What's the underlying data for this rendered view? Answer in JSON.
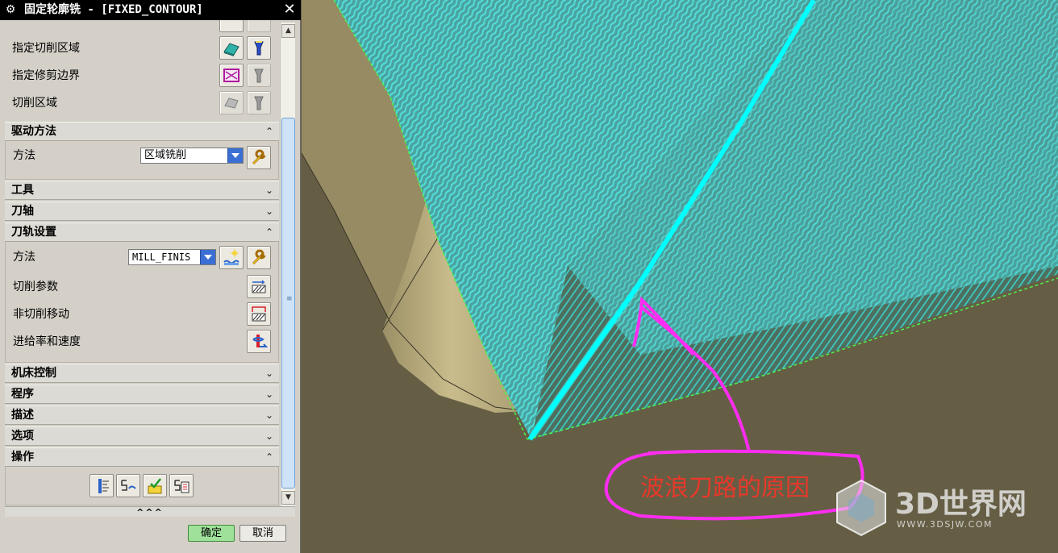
{
  "dialog": {
    "title": "固定轮廓铣 - [FIXED_CONTOUR]",
    "top_rows": [
      {
        "label": "指定切削区域"
      },
      {
        "label": "指定修剪边界"
      },
      {
        "label": "切削区域"
      }
    ],
    "sections": {
      "drive_method": {
        "title": "驱动方法",
        "method_label": "方法",
        "method_value": "区域铣削"
      },
      "tool": {
        "title": "工具"
      },
      "tool_axis": {
        "title": "刀轴"
      },
      "path_settings": {
        "title": "刀轨设置",
        "method_label": "方法",
        "method_value": "MILL_FINIS",
        "cut_params": "切削参数",
        "non_cut_moves": "非切削移动",
        "feeds_speeds": "进给率和速度"
      },
      "machine_control": {
        "title": "机床控制"
      },
      "program": {
        "title": "程序"
      },
      "description": {
        "title": "描述"
      },
      "options": {
        "title": "选项"
      },
      "operation": {
        "title": "操作"
      }
    },
    "collapse_label": "^^^",
    "ok_label": "确定",
    "cancel_label": "取消"
  },
  "viewport": {
    "annotation": "波浪刀路的原因",
    "watermark_text": "3D世界网",
    "watermark_url": "WWW.3DSJW.COM"
  },
  "colors": {
    "toolpath_cyan": "#38d6d0",
    "edge_highlight": "#00ffff",
    "annotation_magenta": "#ff2cf2",
    "annotation_text": "#e8382a",
    "model_surface": "#a79c72",
    "ok_button": "#9fe19a"
  }
}
